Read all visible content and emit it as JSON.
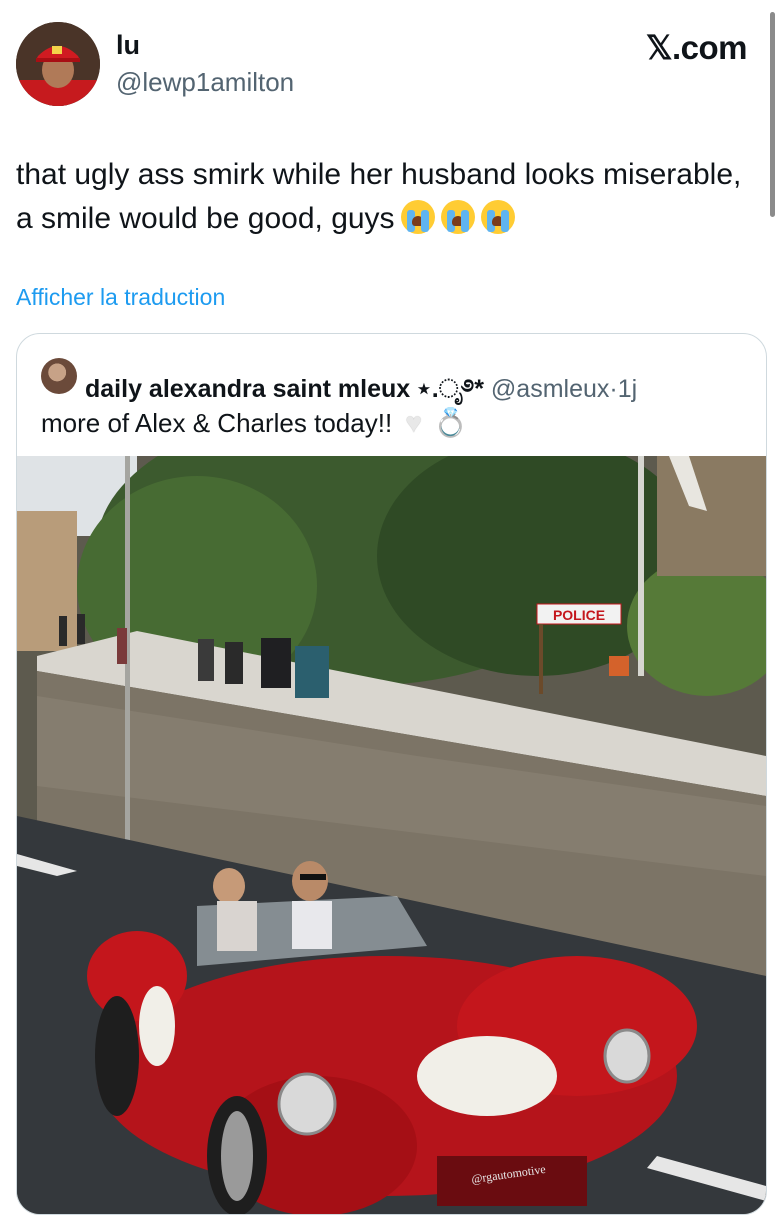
{
  "author": {
    "display_name": "lu",
    "handle": "@lewp1amilton"
  },
  "site_logo": "𝕏.com",
  "tweet": {
    "text": "that ugly ass smirk while her husband looks miserable, a smile would be good, guys",
    "emoji": [
      "loudly-crying-face",
      "loudly-crying-face",
      "loudly-crying-face"
    ]
  },
  "translate_link": "Afficher la traduction",
  "quote": {
    "display_name": "daily alexandra saint mleux",
    "name_decoration": "⋆.ೃ࿔*",
    "handle": "@asmleux",
    "separator": "·",
    "time": "1j",
    "text": "more of Alex & Charles today!!",
    "emoji": [
      "white-heart",
      "ring"
    ],
    "heart_glyph": "♥",
    "ring_glyph": "💍",
    "photo": {
      "sign_text": "POLICE",
      "watermark": "@rgautomotive"
    }
  },
  "colors": {
    "link": "#1d9bf0",
    "secondary_text": "#536471",
    "car_red": "#c4161c",
    "border": "#cfd9de"
  }
}
